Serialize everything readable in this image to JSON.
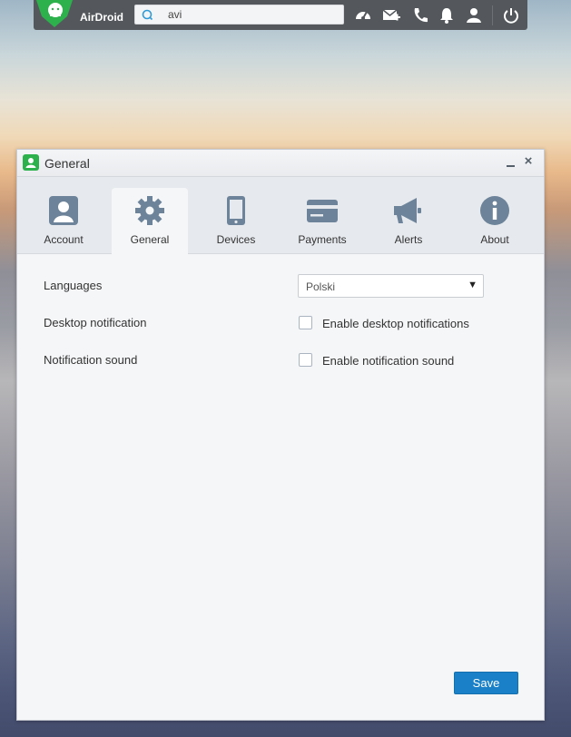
{
  "topbar": {
    "brand": "AirDroid",
    "search": {
      "value": "avi",
      "placeholder": ""
    },
    "icons": [
      "speedometer-icon",
      "mail-add-icon",
      "phone-icon",
      "bell-icon",
      "user-icon",
      "power-icon"
    ]
  },
  "window": {
    "title": "General",
    "tabs": [
      {
        "label": "Account",
        "icon": "account-icon"
      },
      {
        "label": "General",
        "icon": "gear-icon",
        "active": true
      },
      {
        "label": "Devices",
        "icon": "phone-device-icon"
      },
      {
        "label": "Payments",
        "icon": "card-icon"
      },
      {
        "label": "Alerts",
        "icon": "megaphone-icon"
      },
      {
        "label": "About",
        "icon": "info-icon"
      }
    ],
    "settings": {
      "languages_label": "Languages",
      "language_value": "Polski",
      "desktop_notification_label": "Desktop notification",
      "desktop_notification_checkbox": "Enable desktop notifications",
      "desktop_notification_checked": false,
      "notification_sound_label": "Notification sound",
      "notification_sound_checkbox": "Enable notification sound",
      "notification_sound_checked": false
    },
    "save_label": "Save"
  },
  "colors": {
    "accent": "#1a80c7",
    "topbar": "#54585c",
    "brand_green": "#2db14d",
    "icon_gray": "#6c8399"
  }
}
